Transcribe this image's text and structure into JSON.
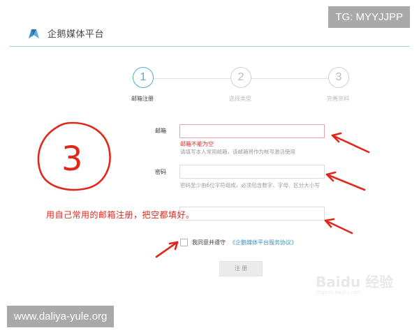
{
  "brand": {
    "name": "企鹅媒体平台"
  },
  "badges": {
    "top_right": "TG: MYYJJPP",
    "bottom_left": "www.daliya-yule.org"
  },
  "steps": [
    {
      "number": "1",
      "label": "邮箱注册",
      "active": true
    },
    {
      "number": "2",
      "label": "选择类型",
      "active": false
    },
    {
      "number": "3",
      "label": "完善资料",
      "active": false
    }
  ],
  "form": {
    "email": {
      "label": "邮箱",
      "value": "",
      "error": "邮箱不能为空",
      "hint": "请填写本人常用邮箱，该邮箱将作为帐号激活使用"
    },
    "password": {
      "label": "密码",
      "value": "",
      "hint": "密码至少由6位字符组成，必须包含数字、字母、区分大小写"
    },
    "confirm": {
      "value": ""
    },
    "agree_text": "我同意并遵守",
    "agree_link": "《企鹅媒体平台服务协议》",
    "submit_label": "注 册"
  },
  "annotation": {
    "text": "用自己常用的邮箱注册，把空都填好。",
    "circled_number": "3"
  },
  "watermark": {
    "text": "Baidu 经验",
    "sub": "jingyan.baidu.com"
  },
  "colors": {
    "accent": "#56a9cf",
    "error": "#d42b2b",
    "annotation": "#e0271c",
    "link": "#3f8fbd"
  },
  "icons": {
    "logo": "penguin-media-logo"
  }
}
